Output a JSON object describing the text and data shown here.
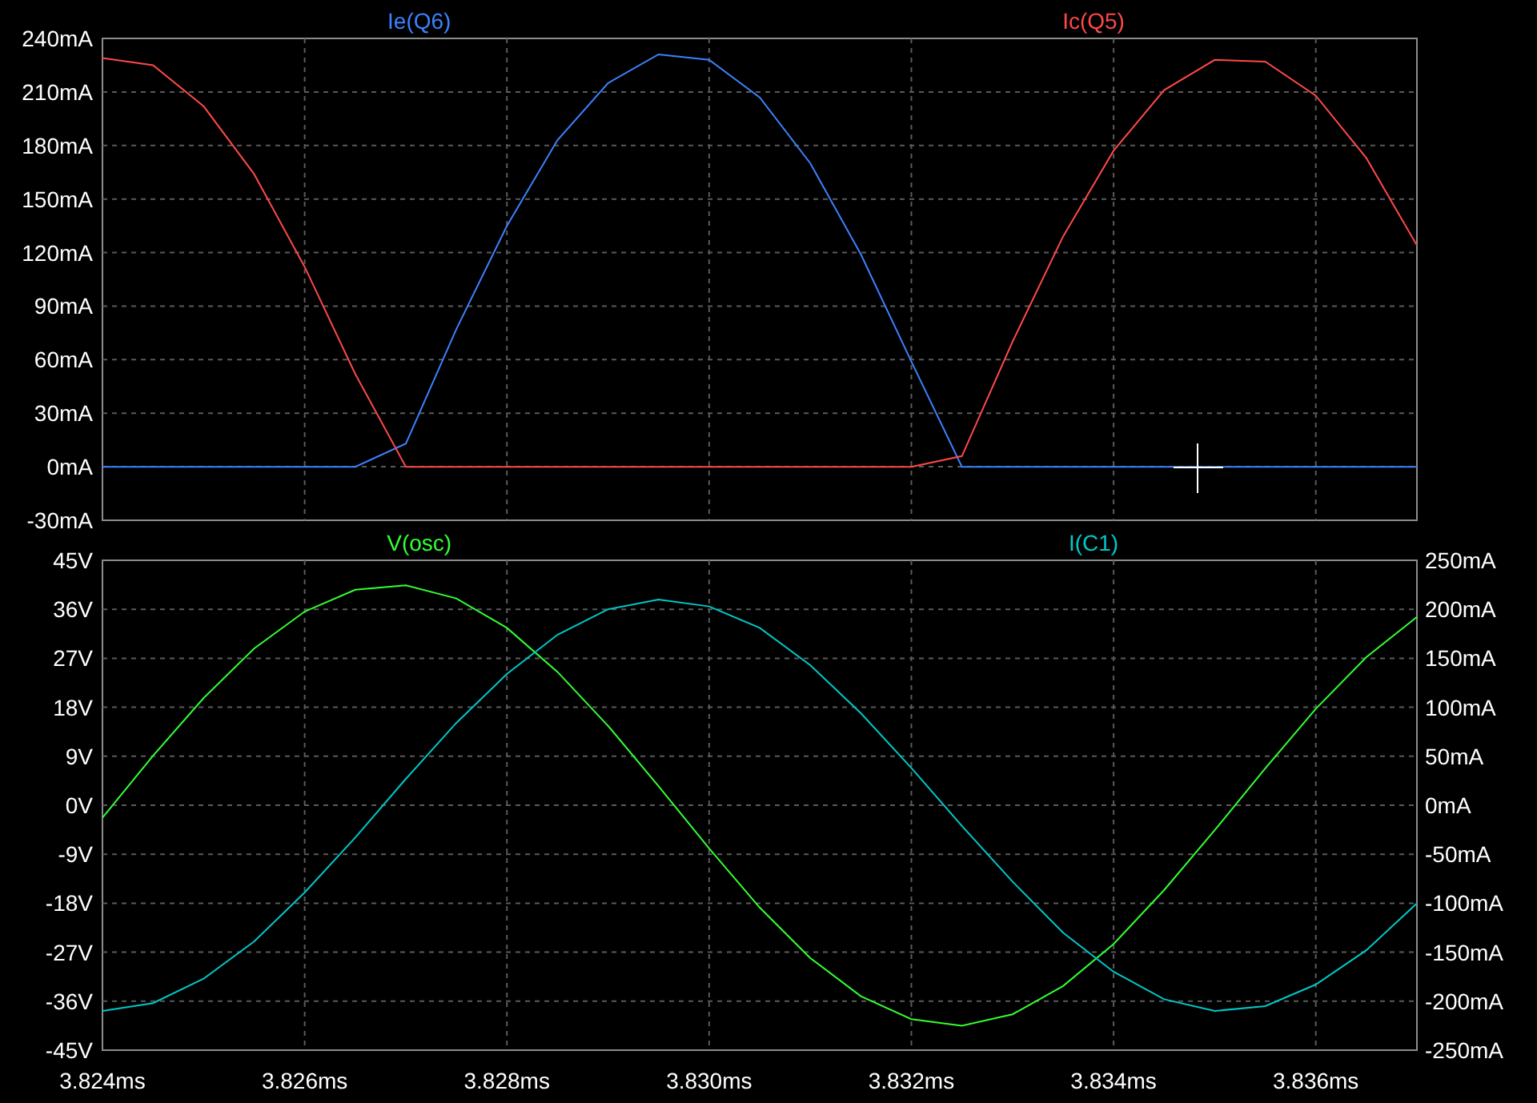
{
  "panes": [
    {
      "chart_data": {
        "type": "line",
        "grid": true,
        "xlim": [
          3.824,
          3.837
        ],
        "ylim": [
          -30,
          240
        ],
        "yticks": [
          {
            "value": -30,
            "label": "-30mA"
          },
          {
            "value": 0,
            "label": "0mA"
          },
          {
            "value": 30,
            "label": "30mA"
          },
          {
            "value": 60,
            "label": "60mA"
          },
          {
            "value": 90,
            "label": "90mA"
          },
          {
            "value": 120,
            "label": "120mA"
          },
          {
            "value": 150,
            "label": "150mA"
          },
          {
            "value": 180,
            "label": "180mA"
          },
          {
            "value": 210,
            "label": "210mA"
          },
          {
            "value": 240,
            "label": "240mA"
          }
        ],
        "x": [
          3.824,
          3.8245,
          3.825,
          3.8255,
          3.826,
          3.8265,
          3.827,
          3.8275,
          3.828,
          3.8285,
          3.829,
          3.8295,
          3.83,
          3.8305,
          3.831,
          3.8315,
          3.832,
          3.8325,
          3.833,
          3.8335,
          3.834,
          3.8345,
          3.835,
          3.8355,
          3.836,
          3.8365,
          3.837
        ],
        "series": [
          {
            "name": "Ie(Q6)",
            "color": "#3c82ff",
            "values": [
              0,
              0,
              0,
              0,
              0,
              0,
              13,
              77,
              135,
              183,
              215,
              231,
              228,
              207,
              170,
              119,
              59,
              0,
              0,
              0,
              0,
              0,
              0,
              0,
              0,
              0,
              0
            ]
          },
          {
            "name": "Ic(Q5)",
            "color": "#ff4848",
            "values": [
              229,
              225,
              202,
              164,
              112,
              52,
              0,
              0,
              0,
              0,
              0,
              0,
              0,
              0,
              0,
              0,
              0,
              6,
              70,
              129,
              177,
              211,
              228,
              227,
              208,
              173,
              124
            ]
          }
        ]
      }
    },
    {
      "chart_data": {
        "type": "line",
        "grid": true,
        "xlim": [
          3.824,
          3.837
        ],
        "ylim": [
          -45,
          45
        ],
        "xticks": [
          {
            "value": 3.824,
            "label": "3.824ms"
          },
          {
            "value": 3.826,
            "label": "3.826ms"
          },
          {
            "value": 3.828,
            "label": "3.828ms"
          },
          {
            "value": 3.83,
            "label": "3.830ms"
          },
          {
            "value": 3.832,
            "label": "3.832ms"
          },
          {
            "value": 3.834,
            "label": "3.834ms"
          },
          {
            "value": 3.836,
            "label": "3.836ms"
          }
        ],
        "yticks": [
          {
            "value": -45,
            "label": "-45V"
          },
          {
            "value": -36,
            "label": "-36V"
          },
          {
            "value": -27,
            "label": "-27V"
          },
          {
            "value": -18,
            "label": "-18V"
          },
          {
            "value": -9,
            "label": "-9V"
          },
          {
            "value": 0,
            "label": "0V"
          },
          {
            "value": 9,
            "label": "9V"
          },
          {
            "value": 18,
            "label": "18V"
          },
          {
            "value": 27,
            "label": "27V"
          },
          {
            "value": 36,
            "label": "36V"
          },
          {
            "value": 45,
            "label": "45V"
          }
        ],
        "y2lim": [
          -250,
          250
        ],
        "y2ticks": [
          {
            "value": -250,
            "label": "-250mA"
          },
          {
            "value": -200,
            "label": "-200mA"
          },
          {
            "value": -150,
            "label": "-150mA"
          },
          {
            "value": -100,
            "label": "-100mA"
          },
          {
            "value": -50,
            "label": "-50mA"
          },
          {
            "value": 0,
            "label": "0mA"
          },
          {
            "value": 50,
            "label": "50mA"
          },
          {
            "value": 100,
            "label": "100mA"
          },
          {
            "value": 150,
            "label": "150mA"
          },
          {
            "value": 200,
            "label": "200mA"
          },
          {
            "value": 250,
            "label": "250mA"
          }
        ],
        "x": [
          3.824,
          3.8245,
          3.825,
          3.8255,
          3.826,
          3.8265,
          3.827,
          3.8275,
          3.828,
          3.8285,
          3.829,
          3.8295,
          3.83,
          3.8305,
          3.831,
          3.8315,
          3.832,
          3.8325,
          3.833,
          3.8335,
          3.834,
          3.8345,
          3.835,
          3.8355,
          3.836,
          3.8365,
          3.837
        ],
        "series": [
          {
            "name": "V(osc)",
            "color": "#33ff33",
            "values": [
              -2.3,
              9.1,
              19.7,
              28.8,
              35.6,
              39.6,
              40.4,
              38.0,
              32.6,
              24.5,
              14.6,
              3.5,
              -7.9,
              -18.8,
              -28.1,
              -35.1,
              -39.3,
              -40.5,
              -38.4,
              -33.2,
              -25.5,
              -15.6,
              -4.6,
              6.8,
              17.7,
              27.2,
              34.6
            ]
          },
          {
            "name": "I(C1)",
            "color": "#00c8c8",
            "axis": "y2",
            "values": [
              -210,
              -202,
              -177,
              -139,
              -89,
              -33,
              27,
              84,
              134,
              174,
              200,
              210,
              203,
              181,
              143,
              94,
              38,
              -21,
              -78,
              -130,
              -170,
              -198,
              -210,
              -205,
              -183,
              -148,
              -100
            ]
          }
        ]
      }
    }
  ]
}
